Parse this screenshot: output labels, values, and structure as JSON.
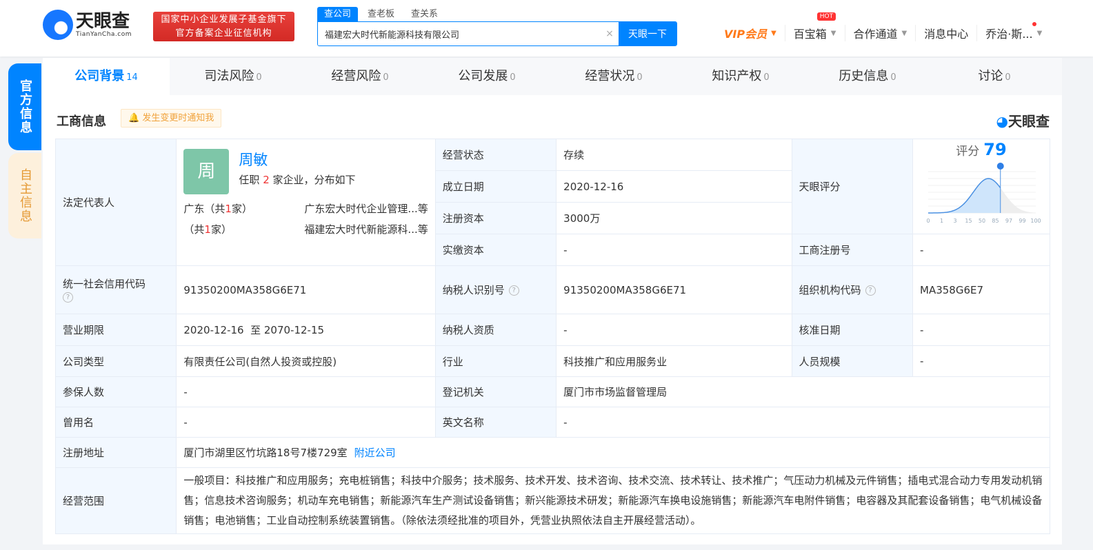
{
  "header": {
    "logo_cn": "天眼查",
    "logo_en": "TianYanCha.com",
    "badge_line1": "国家中小企业发展子基金旗下",
    "badge_line2": "官方备案企业征信机构",
    "search_tabs": [
      "查公司",
      "查老板",
      "查关系"
    ],
    "search_value": "福建宏大时代新能源科技有限公司",
    "search_button": "天眼一下",
    "clear": "×",
    "nav": {
      "vip": "VIP会员",
      "toolbox": "百宝箱",
      "hot": "HOT",
      "partner": "合作通道",
      "messages": "消息中心",
      "user": "乔治·斯..."
    }
  },
  "side_tabs": [
    "官方信息",
    "自主信息"
  ],
  "tabs": [
    {
      "label": "公司背景",
      "count": "14"
    },
    {
      "label": "司法风险",
      "count": "0"
    },
    {
      "label": "经营风险",
      "count": "0"
    },
    {
      "label": "公司发展",
      "count": "0"
    },
    {
      "label": "经营状况",
      "count": "0"
    },
    {
      "label": "知识产权",
      "count": "0"
    },
    {
      "label": "历史信息",
      "count": "0"
    },
    {
      "label": "讨论",
      "count": "0"
    }
  ],
  "section": {
    "title": "工商信息",
    "notify": "发生变更时通知我",
    "brand": "天眼查"
  },
  "legal_rep": {
    "label": "法定代表人",
    "avatar": "周",
    "name": "周敏",
    "jobs_prefix": "任职",
    "jobs_count": "2",
    "jobs_suffix": "家企业，分布如下",
    "dist": [
      {
        "region": "广东（共",
        "n": "1",
        "end": "家）",
        "companies": "广东宏大时代企业管理...等"
      },
      {
        "region": "（共",
        "n": "1",
        "end": "家）",
        "companies": "福建宏大时代新能源科...等"
      }
    ]
  },
  "fields": {
    "status": {
      "label": "经营状态",
      "value": "存续"
    },
    "founded": {
      "label": "成立日期",
      "value": "2020-12-16"
    },
    "reg_capital": {
      "label": "注册资本",
      "value": "3000万"
    },
    "paid_capital": {
      "label": "实缴资本",
      "value": "-"
    },
    "score_label": "天眼评分",
    "reg_no": {
      "label": "工商注册号",
      "value": "-"
    },
    "credit_code": {
      "label": "统一社会信用代码",
      "value": "91350200MA358G6E71"
    },
    "taxpayer_id": {
      "label": "纳税人识别号",
      "value": "91350200MA358G6E71"
    },
    "org_code": {
      "label": "组织机构代码",
      "value": "MA358G6E7"
    },
    "term": {
      "label": "营业期限",
      "value": "2020-12-16  至 2070-12-15"
    },
    "taxpayer_quality": {
      "label": "纳税人资质",
      "value": "-"
    },
    "approval_date": {
      "label": "核准日期",
      "value": "-"
    },
    "company_type": {
      "label": "公司类型",
      "value": "有限责任公司(自然人投资或控股)"
    },
    "industry": {
      "label": "行业",
      "value": "科技推广和应用服务业"
    },
    "staff_size": {
      "label": "人员规模",
      "value": "-"
    },
    "insured": {
      "label": "参保人数",
      "value": "-"
    },
    "authority": {
      "label": "登记机关",
      "value": "厦门市市场监督管理局"
    },
    "former_name": {
      "label": "曾用名",
      "value": "-"
    },
    "english_name": {
      "label": "英文名称",
      "value": "-"
    },
    "address": {
      "label": "注册地址",
      "value": "厦门市湖里区竹坑路18号7楼729室",
      "link": "附近公司"
    },
    "scope": {
      "label": "经营范围",
      "value": "一般项目：科技推广和应用服务；充电桩销售；科技中介服务；技术服务、技术开发、技术咨询、技术交流、技术转让、技术推广；气压动力机械及元件销售；插电式混合动力专用发动机销售；信息技术咨询服务；机动车充电销售；新能源汽车生产测试设备销售；新兴能源技术研发；新能源汽车换电设施销售；新能源汽车电附件销售；电容器及其配套设备销售；电气机械设备销售；电池销售；工业自动控制系统装置销售。（除依法须经批准的项目外，凭营业执照依法自主开展经营活动）。"
    }
  },
  "chart_data": {
    "type": "area",
    "title": "评分",
    "score": 79,
    "x_ticks": [
      "0",
      "1",
      "3",
      "15",
      "50",
      "85",
      "97",
      "99",
      "100"
    ],
    "marker_percentile": 79
  }
}
